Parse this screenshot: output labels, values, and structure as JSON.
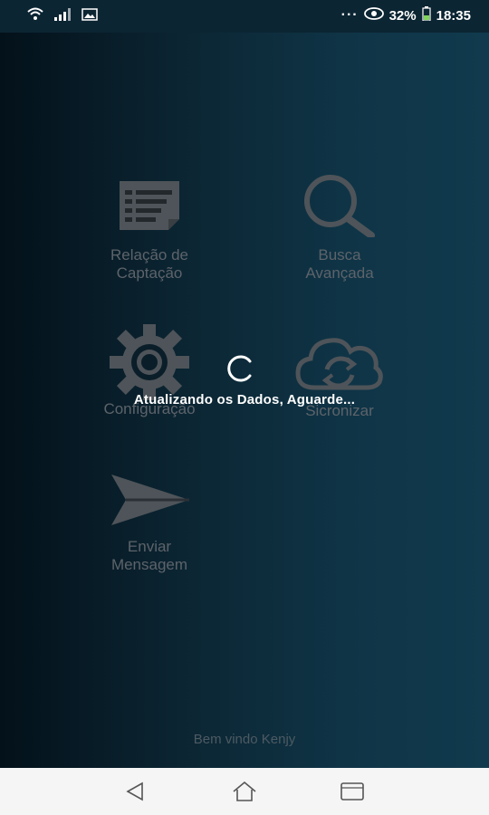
{
  "status_bar": {
    "left_icons": [
      "wifi-icon",
      "signal-icon",
      "image-notification-icon"
    ],
    "dots": "···",
    "battery_percent": "32%",
    "time": "18:35"
  },
  "menu": {
    "items": [
      {
        "label": "Relação de\nCaptação",
        "icon": "list-document-icon"
      },
      {
        "label": "Busca\nAvançada",
        "icon": "search-icon"
      },
      {
        "label": "Configuração",
        "icon": "gear-icon"
      },
      {
        "label": "Sicronizar",
        "icon": "cloud-sync-icon"
      },
      {
        "label": "Enviar\nMensagem",
        "icon": "send-icon"
      }
    ]
  },
  "loading": {
    "message": "Atualizando os Dados, Aguarde..."
  },
  "welcome": "Bem vindo Kenjy",
  "colors": {
    "status_bar_bg": "#0c2533",
    "icon_color": "#555b60",
    "nav_bar_bg": "#f5f5f5"
  }
}
